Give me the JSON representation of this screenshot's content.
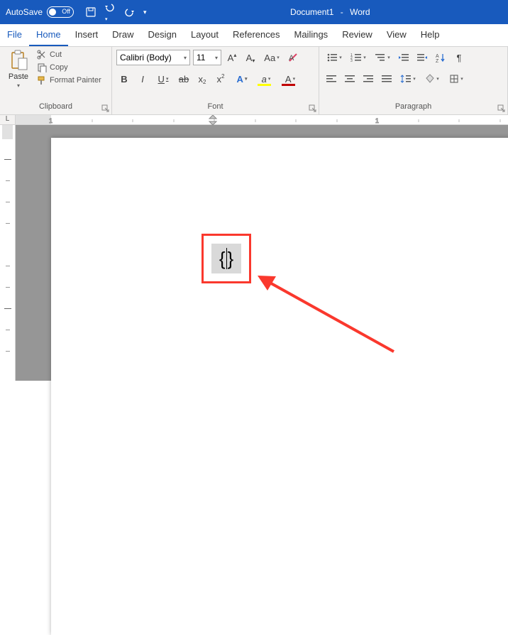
{
  "titlebar": {
    "autosave_label": "AutoSave",
    "autosave_state": "Off",
    "doc_name": "Document1",
    "dash": "-",
    "app_name": "Word"
  },
  "tabs": {
    "file": "File",
    "home": "Home",
    "insert": "Insert",
    "draw": "Draw",
    "design": "Design",
    "layout": "Layout",
    "references": "References",
    "mailings": "Mailings",
    "review": "Review",
    "view": "View",
    "help": "Help"
  },
  "ribbon": {
    "clipboard": {
      "paste": "Paste",
      "cut": "Cut",
      "copy": "Copy",
      "format_painter": "Format Painter",
      "label": "Clipboard"
    },
    "font": {
      "name": "Calibri (Body)",
      "size": "11",
      "label": "Font"
    },
    "paragraph": {
      "label": "Paragraph"
    }
  },
  "ruler": {
    "corner": "L",
    "marks": [
      "1",
      "1"
    ]
  },
  "document": {
    "field_left": "{",
    "field_right": "}"
  }
}
